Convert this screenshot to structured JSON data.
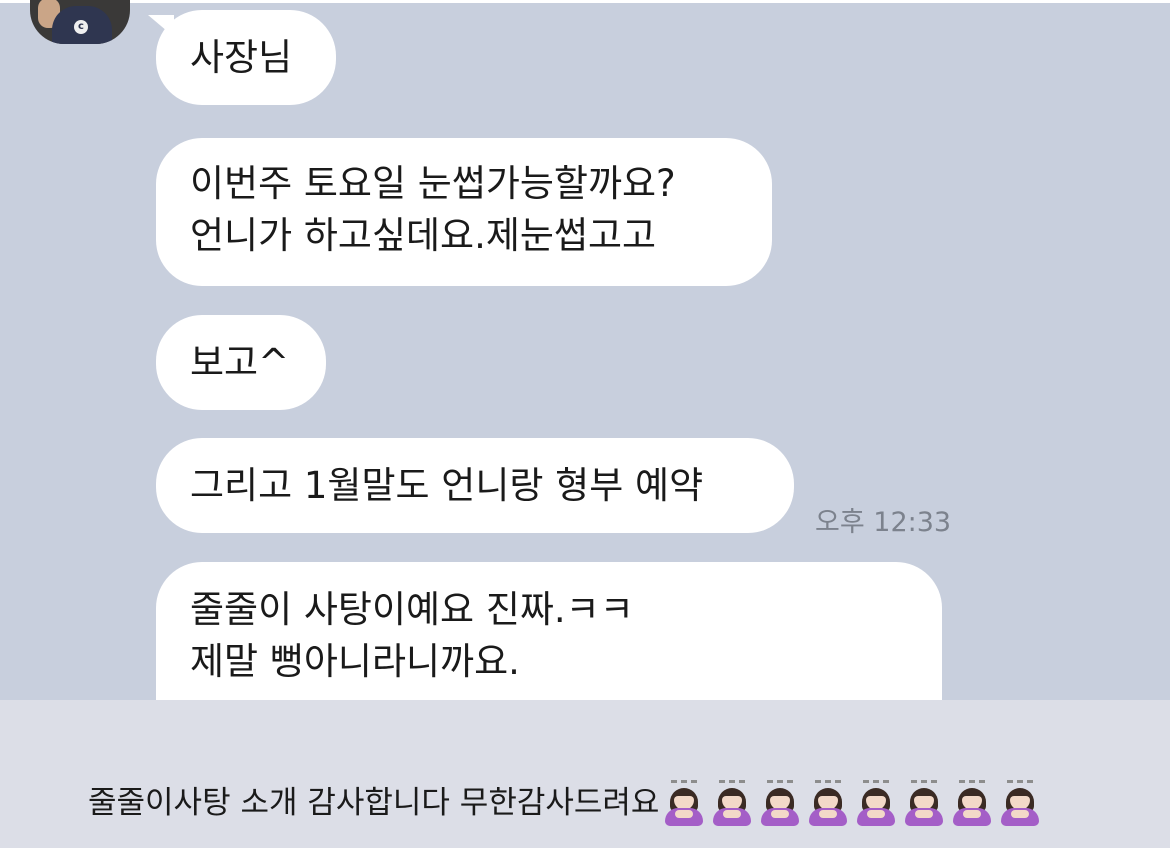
{
  "chat": {
    "messages": [
      {
        "lines": [
          "사장님"
        ]
      },
      {
        "lines": [
          "이번주 토요일 눈썹가능할까요?",
          "언니가 하고싶데요.제눈썹고고"
        ]
      },
      {
        "lines": [
          "보고^"
        ]
      },
      {
        "lines": [
          "그리고 1월말도 언니랑 형부 예약"
        ]
      },
      {
        "lines": [
          "줄줄이 사탕이예요 진짜.ㅋㅋ",
          "제말 뻥아니라니까요."
        ]
      }
    ],
    "timestamp": "오후 12:33"
  },
  "caption": {
    "text": "줄줄이사탕 소개 감사합니다 무한감사드려요",
    "emoji_icon": "person-bowing-icon",
    "emoji_count": 8
  },
  "colors": {
    "chat_background": "#c8cfdd",
    "bubble": "#ffffff",
    "caption_background": "#dcdee7",
    "timestamp_text": "#7c828d"
  }
}
